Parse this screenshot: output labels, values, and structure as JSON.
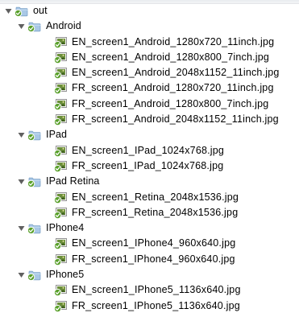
{
  "tree": {
    "root": {
      "name": "out",
      "icon": "folder-synced-icon",
      "expanded": true,
      "children": [
        {
          "name": "Android",
          "icon": "folder-synced-icon",
          "expanded": true,
          "files": [
            "EN_screen1_Android_1280x720_11inch.jpg",
            "EN_screen1_Android_1280x800_7inch.jpg",
            "EN_screen1_Android_2048x1152_11inch.jpg",
            "FR_screen1_Android_1280x720_11inch.jpg",
            "FR_screen1_Android_1280x800_7inch.jpg",
            "FR_screen1_Android_2048x1152_11inch.jpg"
          ]
        },
        {
          "name": "IPad",
          "icon": "folder-synced-icon",
          "expanded": true,
          "files": [
            "EN_screen1_IPad_1024x768.jpg",
            "FR_screen1_IPad_1024x768.jpg"
          ]
        },
        {
          "name": "IPad Retina",
          "icon": "folder-synced-icon",
          "expanded": true,
          "files": [
            "EN_screen1_Retina_2048x1536.jpg",
            "FR_screen1_Retina_2048x1536.jpg"
          ]
        },
        {
          "name": "IPhone4",
          "icon": "folder-synced-icon",
          "expanded": true,
          "files": [
            "EN_screen1_IPhone4_960x640.jpg",
            "FR_screen1_IPhone4_960x640.jpg"
          ]
        },
        {
          "name": "IPhone5",
          "icon": "folder-synced-icon",
          "expanded": true,
          "files": [
            "EN_screen1_IPhone5_1136x640.jpg",
            "FR_screen1_IPhone5_1136x640.jpg"
          ]
        }
      ]
    },
    "file_icon": "jpg-image-synced-icon"
  },
  "colors": {
    "background": "#ffffff",
    "folder": "#a9c8e6",
    "sync_badge": "#5aa02c",
    "disclosure_triangle": "#606060"
  }
}
